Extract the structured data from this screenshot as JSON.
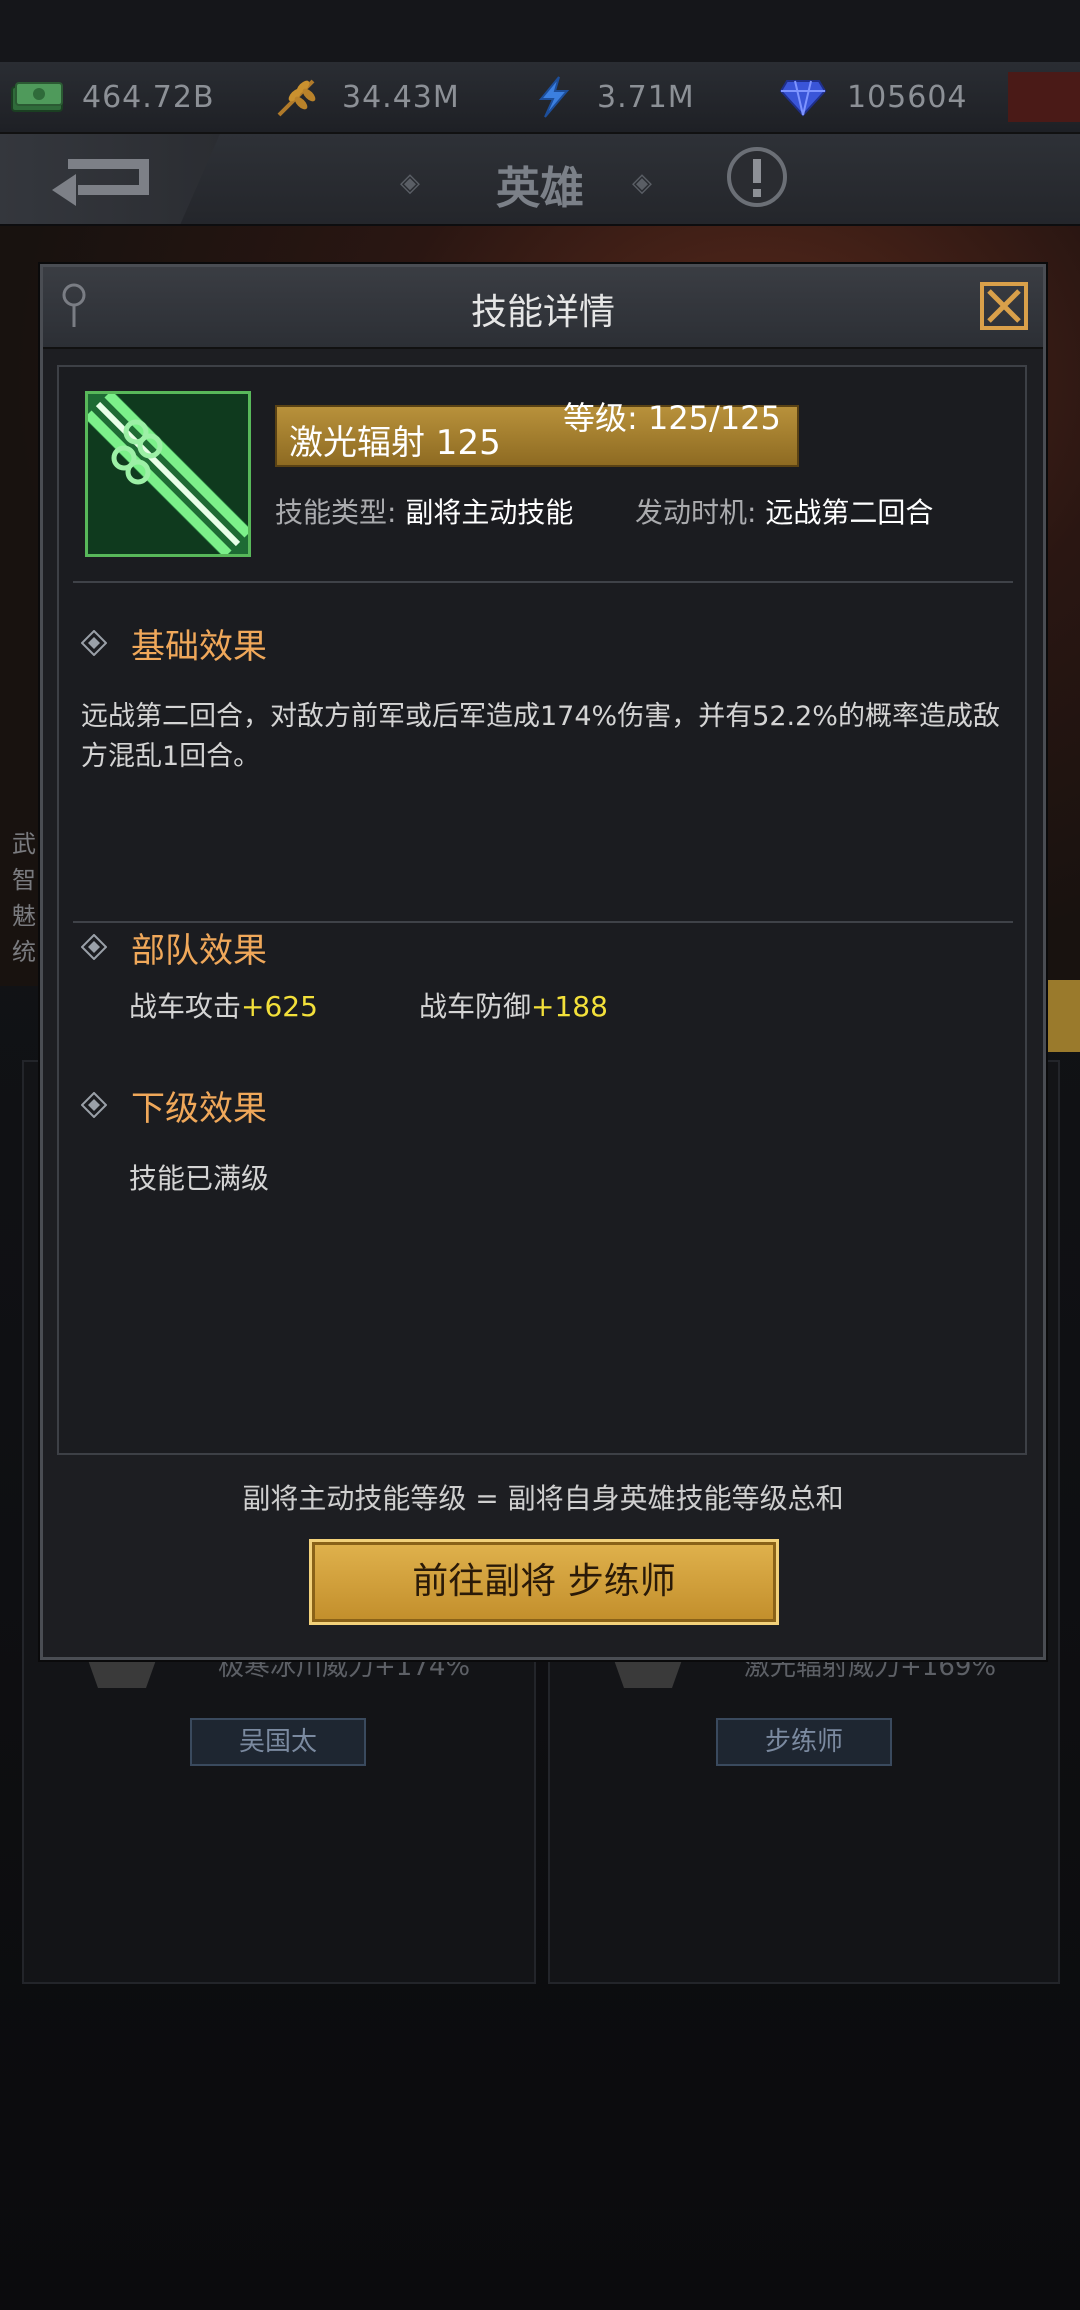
{
  "resources": {
    "money": "464.72B",
    "food": "34.43M",
    "energy": "3.71M",
    "gems": "105604"
  },
  "header": {
    "title": "英雄"
  },
  "background": {
    "stat_labels": [
      "武",
      "智",
      "魅",
      "统"
    ],
    "left_card": {
      "effect": "极寒冰川威力+174%",
      "button": "吴国太"
    },
    "right_card": {
      "effect": "激光辐射威力+169%",
      "button": "步练师"
    }
  },
  "modal": {
    "title": "技能详情",
    "skill": {
      "name": "激光辐射 125",
      "level": "等级: 125/125",
      "type_label": "技能类型:",
      "type_value": "副将主动技能",
      "trigger_label": "发动时机:",
      "trigger_value": "远战第二回合"
    },
    "basic": {
      "title": "基础效果",
      "text": "远战第二回合，对敌方前军或后军造成174%伤害，并有52.2%的概率造成敌方混乱1回合。"
    },
    "troop": {
      "title": "部队效果",
      "stats": [
        {
          "label": "战车攻击",
          "value": "+625"
        },
        {
          "label": "战车防御",
          "value": "+188"
        }
      ]
    },
    "next": {
      "title": "下级效果",
      "text": "技能已满级"
    },
    "footer_note": "副将主动技能等级 = 副将自身英雄技能等级总和",
    "go_button": "前往副将 步练师"
  },
  "colors": {
    "accent_orange": "#f0a85a",
    "bonus_yellow": "#f3e03a",
    "gold_button": "#d4a23e",
    "skill_green": "#58b85a"
  }
}
